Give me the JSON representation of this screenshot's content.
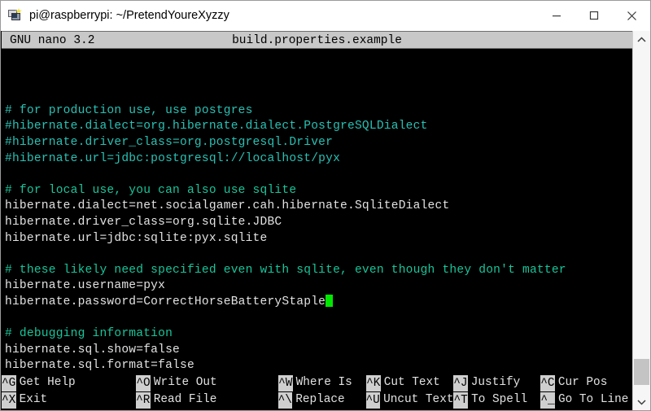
{
  "window": {
    "title": "pi@raspberrypi: ~/PretendYoureXyzzy",
    "icon": "putty-terminal-icon",
    "controls": {
      "minimize": "minimize-icon",
      "maximize": "maximize-icon",
      "close": "close-icon"
    },
    "colors": {
      "titlebar_bg": "#ffffff",
      "title_text": "#000000",
      "terminal_bg": "#000000",
      "terminal_fg": "#d6d6d6",
      "comment_cyan": "#29c1b4",
      "comment_green": "#18c59a",
      "cursor_green": "#00e800",
      "nano_header_bg": "#c8c8c8",
      "shortcut_key_bg": "#cfcfcf",
      "scrollbar_track": "#f6f6f6",
      "scrollbar_thumb": "#c4c4c4"
    }
  },
  "nano": {
    "version_label": "GNU nano 3.2",
    "filename": "build.properties.example",
    "lines": [
      {
        "text": "",
        "style": "blank"
      },
      {
        "text": "",
        "style": "blank"
      },
      {
        "text": "",
        "style": "blank"
      },
      {
        "text": "# for production use, use postgres",
        "style": "comment"
      },
      {
        "text": "#hibernate.dialect=org.hibernate.dialect.PostgreSQLDialect",
        "style": "comment"
      },
      {
        "text": "#hibernate.driver_class=org.postgresql.Driver",
        "style": "comment"
      },
      {
        "text": "#hibernate.url=jdbc:postgresql://localhost/pyx",
        "style": "comment"
      },
      {
        "text": "",
        "style": "blank"
      },
      {
        "text": "# for local use, you can also use sqlite",
        "style": "comment-alt"
      },
      {
        "text": "hibernate.dialect=net.socialgamer.cah.hibernate.SqliteDialect",
        "style": "text"
      },
      {
        "text": "hibernate.driver_class=org.sqlite.JDBC",
        "style": "text"
      },
      {
        "text": "hibernate.url=jdbc:sqlite:pyx.sqlite",
        "style": "text"
      },
      {
        "text": "",
        "style": "blank"
      },
      {
        "text": "# these likely need specified even with sqlite, even though they don't matter",
        "style": "comment-alt"
      },
      {
        "text": "hibernate.username=pyx",
        "style": "text"
      },
      {
        "text": "hibernate.password=CorrectHorseBatteryStaple",
        "style": "text-cursor"
      },
      {
        "text": "",
        "style": "blank"
      },
      {
        "text": "# debugging information",
        "style": "comment-alt"
      },
      {
        "text": "hibernate.sql.show=false",
        "style": "text"
      },
      {
        "text": "hibernate.sql.format=false",
        "style": "text"
      }
    ],
    "shortcuts_row1": [
      {
        "key": "^G",
        "label": "Get Help"
      },
      {
        "key": "^O",
        "label": "Write Out"
      },
      {
        "key": "^W",
        "label": "Where Is"
      },
      {
        "key": "^K",
        "label": "Cut Text"
      },
      {
        "key": "^J",
        "label": "Justify"
      },
      {
        "key": "^C",
        "label": "Cur Pos"
      }
    ],
    "shortcuts_row2": [
      {
        "key": "^X",
        "label": "Exit"
      },
      {
        "key": "^R",
        "label": "Read File"
      },
      {
        "key": "^\\",
        "label": "Replace"
      },
      {
        "key": "^U",
        "label": "Uncut Text"
      },
      {
        "key": "^T",
        "label": "To Spell"
      },
      {
        "key": "^_",
        "label": "Go To Line"
      }
    ]
  },
  "scrollbar": {
    "up_arrow": "chevron-up-icon",
    "down_arrow": "chevron-down-icon"
  }
}
